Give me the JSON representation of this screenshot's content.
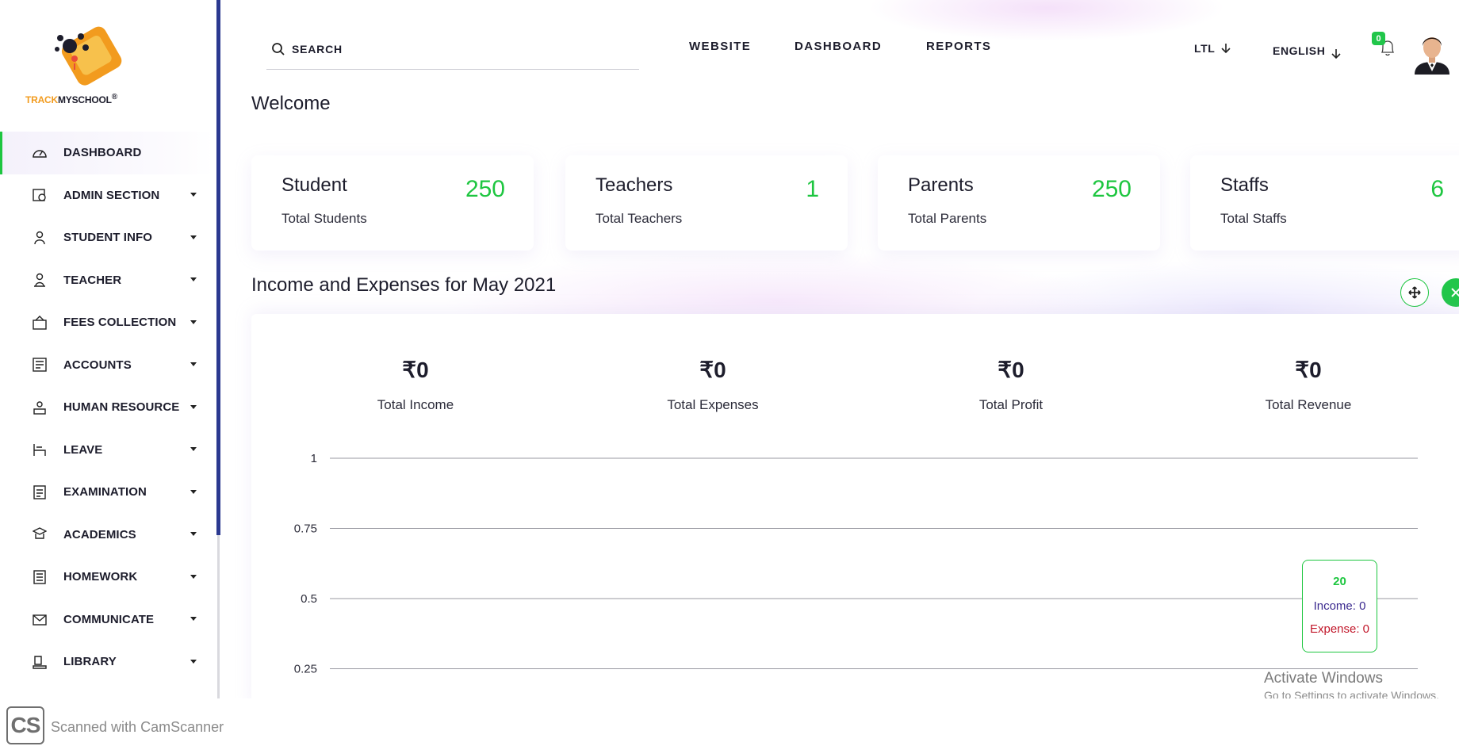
{
  "app": {
    "logo_text_orange": "TRACK",
    "logo_text_dark": "MYSCHOOL",
    "logo_mark": "®"
  },
  "sidebar": {
    "items": [
      {
        "label": "DASHBOARD",
        "icon": "gauge-icon",
        "active": true,
        "caret": false
      },
      {
        "label": "ADMIN SECTION",
        "icon": "admin-icon",
        "caret": true
      },
      {
        "label": "STUDENT INFO",
        "icon": "student-icon",
        "caret": true
      },
      {
        "label": "TEACHER",
        "icon": "teacher-icon",
        "caret": true
      },
      {
        "label": "FEES COLLECTION",
        "icon": "fees-icon",
        "caret": true
      },
      {
        "label": "ACCOUNTS",
        "icon": "accounts-icon",
        "caret": true
      },
      {
        "label": "HUMAN RESOURCE",
        "icon": "hr-icon",
        "caret": true
      },
      {
        "label": "LEAVE",
        "icon": "leave-icon",
        "caret": true
      },
      {
        "label": "EXAMINATION",
        "icon": "exam-icon",
        "caret": true
      },
      {
        "label": "ACADEMICS",
        "icon": "academics-icon",
        "caret": true
      },
      {
        "label": "HOMEWORK",
        "icon": "homework-icon",
        "caret": true
      },
      {
        "label": "COMMUNICATE",
        "icon": "communicate-icon",
        "caret": true
      },
      {
        "label": "LIBRARY",
        "icon": "library-icon",
        "caret": true
      }
    ]
  },
  "header": {
    "search_placeholder": "SEARCH",
    "nav": [
      "WEBSITE",
      "DASHBOARD",
      "REPORTS"
    ],
    "direction": "LTL",
    "language": "ENGLISH",
    "notification_count": "0"
  },
  "main": {
    "welcome": "Welcome",
    "cards": [
      {
        "title": "Student",
        "sub": "Total Students",
        "value": "250"
      },
      {
        "title": "Teachers",
        "sub": "Total Teachers",
        "value": "1"
      },
      {
        "title": "Parents",
        "sub": "Total Parents",
        "value": "250"
      },
      {
        "title": "Staffs",
        "sub": "Total Staffs",
        "value": "6"
      }
    ],
    "section_title": "Income and Expenses for May 2021",
    "metrics": [
      {
        "value": "₹0",
        "label": "Total Income"
      },
      {
        "value": "₹0",
        "label": "Total Expenses"
      },
      {
        "value": "₹0",
        "label": "Total Profit"
      },
      {
        "value": "₹0",
        "label": "Total Revenue"
      }
    ],
    "tooltip": {
      "x": "20",
      "income": "Income: 0",
      "expense": "Expense: 0"
    }
  },
  "chart_data": {
    "type": "line",
    "y_ticks": [
      "1",
      "0.75",
      "0.5",
      "0.25"
    ],
    "ylim": [
      0,
      1
    ],
    "grid": true,
    "series": [
      {
        "name": "Income",
        "values": [
          0
        ]
      },
      {
        "name": "Expense",
        "values": [
          0
        ]
      }
    ],
    "highlight_x": 20
  },
  "overlay": {
    "activate_title": "Activate Windows",
    "activate_sub": "Go to Settings to activate Windows.",
    "cs_logo": "CS",
    "cs_text": "Scanned with CamScanner"
  },
  "colors": {
    "accent_green": "#1ec640",
    "sidebar_border": "#2b3990",
    "logo_orange": "#f29b1e"
  }
}
